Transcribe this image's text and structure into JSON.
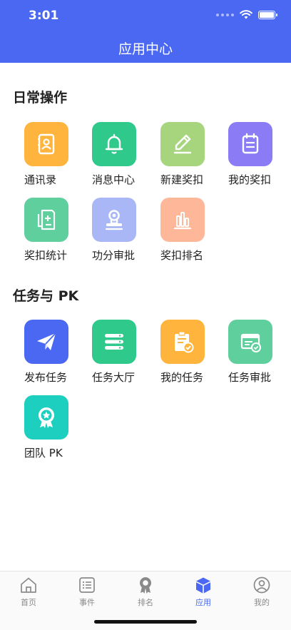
{
  "status_bar": {
    "time": "3:01"
  },
  "header": {
    "title": "应用中心"
  },
  "sections": [
    {
      "title": "日常操作",
      "apps": [
        {
          "label": "通讯录",
          "icon": "contacts-icon",
          "color": "#ffb53d"
        },
        {
          "label": "消息中心",
          "icon": "bell-icon",
          "color": "#2ec98b"
        },
        {
          "label": "新建奖扣",
          "icon": "pencil-icon",
          "color": "#a6d57e"
        },
        {
          "label": "我的奖扣",
          "icon": "clipboard-icon",
          "color": "#8b7cf6"
        },
        {
          "label": "奖扣统计",
          "icon": "document-plus-icon",
          "color": "#5fcf9d"
        },
        {
          "label": "功分审批",
          "icon": "stamp-icon",
          "color": "#a9b7f7"
        },
        {
          "label": "奖扣排名",
          "icon": "bar-chart-icon",
          "color": "#ffb79a"
        }
      ]
    },
    {
      "title": "任务与 PK",
      "apps": [
        {
          "label": "发布任务",
          "icon": "paper-plane-icon",
          "color": "#4a68f2"
        },
        {
          "label": "任务大厅",
          "icon": "list-stack-icon",
          "color": "#2ec98b"
        },
        {
          "label": "我的任务",
          "icon": "task-check-icon",
          "color": "#ffb53d"
        },
        {
          "label": "任务审批",
          "icon": "approval-icon",
          "color": "#5fcf9d"
        },
        {
          "label": "团队 PK",
          "icon": "badge-star-icon",
          "color": "#1ccfbf"
        }
      ]
    }
  ],
  "tabbar": {
    "items": [
      {
        "label": "首页",
        "icon": "home-icon",
        "active": false
      },
      {
        "label": "事件",
        "icon": "list-icon",
        "active": false
      },
      {
        "label": "排名",
        "icon": "medal-icon",
        "active": false
      },
      {
        "label": "应用",
        "icon": "cube-icon",
        "active": true
      },
      {
        "label": "我的",
        "icon": "user-icon",
        "active": false
      }
    ]
  }
}
